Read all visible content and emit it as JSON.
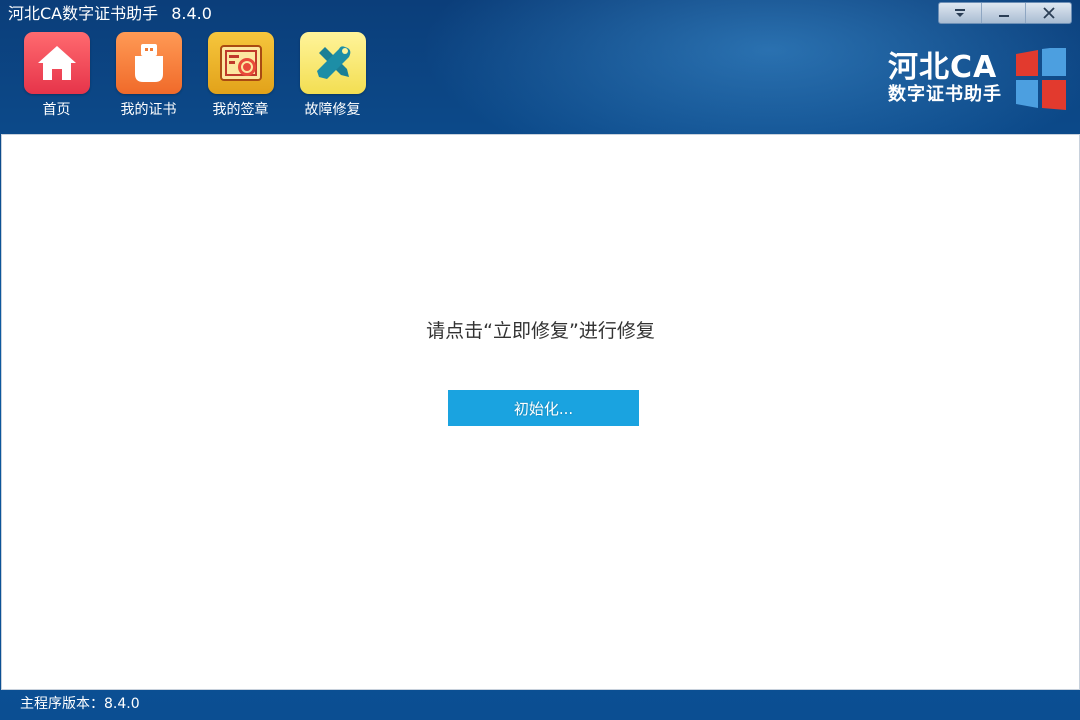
{
  "window": {
    "title": "河北CA数字证书助手",
    "version": "8.4.0",
    "controls": {
      "dropdown_icon": "chevron-down-icon",
      "minimize_icon": "minimize-icon",
      "close_icon": "close-icon"
    }
  },
  "toolbar": {
    "items": [
      {
        "label": "首页",
        "icon": "home-icon",
        "color": "#e6344a"
      },
      {
        "label": "我的证书",
        "icon": "usb-key-icon",
        "color": "#f06a2a"
      },
      {
        "label": "我的签章",
        "icon": "seal-icon",
        "color": "#e2a21a"
      },
      {
        "label": "故障修复",
        "icon": "repair-tools-icon",
        "color": "#f3de52"
      }
    ]
  },
  "brand": {
    "line1": "河北CA",
    "line2": "数字证书助手",
    "logo_icon": "windows-shield-icon"
  },
  "main": {
    "message": "请点击“立即修复”进行修复",
    "button_label": "初始化...",
    "button_color": "#1aa3e0"
  },
  "status": {
    "text": "主程序版本：8.4.0"
  }
}
